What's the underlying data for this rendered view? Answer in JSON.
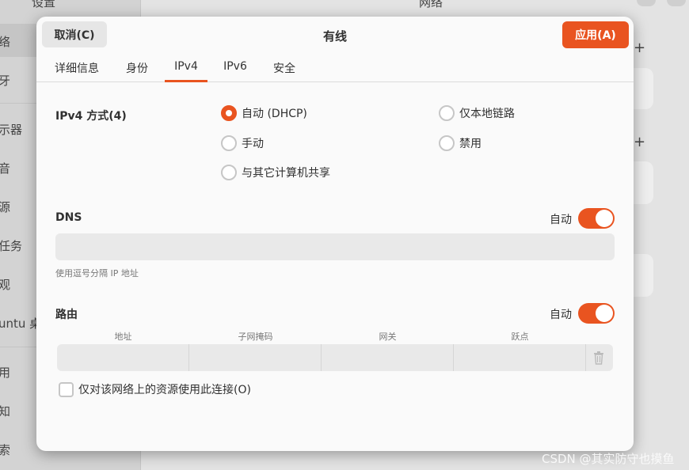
{
  "background": {
    "sidebar_title": "设置",
    "main_title": "网络",
    "sidebar_items": [
      "络",
      "牙",
      "示器",
      "音",
      "源",
      "任务",
      "观",
      "untu 桌",
      "用",
      "知",
      "索"
    ]
  },
  "dialog": {
    "title": "有线",
    "cancel_label": "取消(C)",
    "apply_label": "应用(A)",
    "tabs": [
      "详细信息",
      "身份",
      "IPv4",
      "IPv6",
      "安全"
    ],
    "active_tab": "IPv4",
    "ipv4_method": {
      "label": "IPv4 方式(4)",
      "options": [
        "自动 (DHCP)",
        "仅本地链路",
        "手动",
        "禁用",
        "与其它计算机共享"
      ],
      "selected": "自动 (DHCP)"
    },
    "dns": {
      "label": "DNS",
      "auto_label": "自动",
      "auto_enabled": true,
      "value": "",
      "hint": "使用逗号分隔 IP 地址"
    },
    "routes": {
      "label": "路由",
      "auto_label": "自动",
      "auto_enabled": true,
      "columns": [
        "地址",
        "子网掩码",
        "网关",
        "跃点"
      ]
    },
    "only_local_label": "仅对该网络上的资源使用此连接(O)",
    "only_local_checked": false
  },
  "watermark": "CSDN @其实防守也摸鱼",
  "colors": {
    "accent": "#e95420",
    "dialog_bg": "#fafafa",
    "field_bg": "#e9e9e9"
  }
}
